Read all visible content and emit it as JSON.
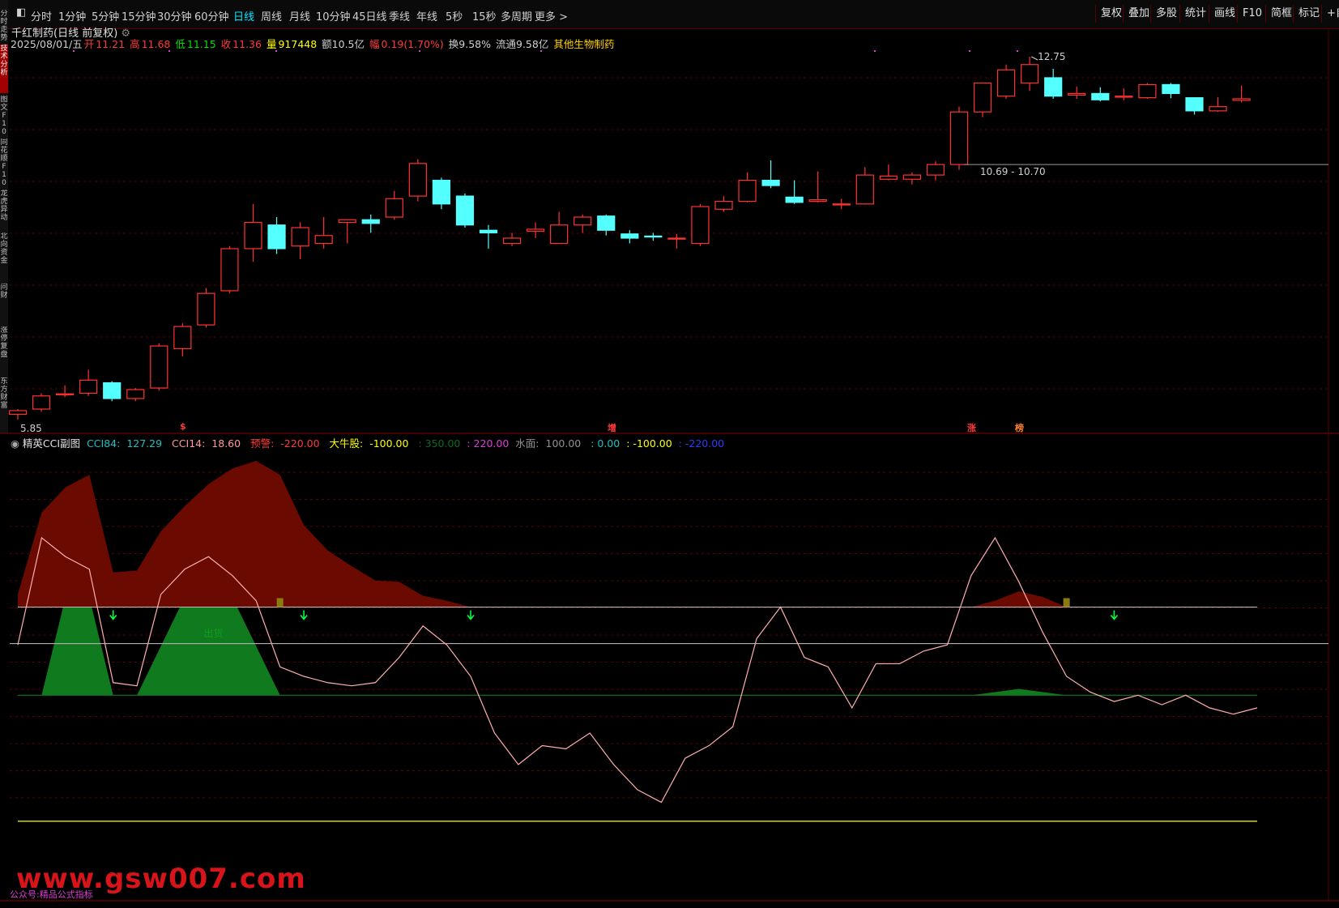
{
  "toolbar": {
    "tabs": [
      "分时",
      "1分钟",
      "5分钟",
      "15分钟",
      "30分钟",
      "60分钟",
      "日线",
      "周线",
      "月线",
      "10分钟",
      "45日线",
      "季线",
      "年线",
      "5秒",
      "15秒",
      "多周期",
      "更多"
    ],
    "active": "日线",
    "right": [
      "复权",
      "叠加",
      "多股",
      "统计",
      "画线",
      "F10",
      "简框",
      "标记",
      "+自"
    ]
  },
  "sidebar": {
    "tabs": [
      "分时走势",
      "技术分析",
      "图文F10",
      "同花顺F10",
      "龙虎异动",
      "北向资金",
      "问财",
      "涨停复盘",
      "东方财富"
    ],
    "active": "技术分析"
  },
  "main": {
    "title": "千红制药(日线 前复权)",
    "date": "2025/08/01/五",
    "open_label": "开",
    "open": "11.21",
    "high_label": "高",
    "high": "11.68",
    "low_label": "低",
    "low": "11.15",
    "close_label": "收",
    "close": "11.36",
    "vol_label": "量",
    "vol": "917448",
    "amount": "额10.5亿",
    "change_label": "幅",
    "change": "0.19(1.70%)",
    "turnover": "换9.58%",
    "float": "流通9.58亿",
    "sector": "其他生物制药",
    "max_label": "12.75",
    "min_label": "5.85",
    "range_label": "10.69 - 10.70",
    "event_markers": [
      "$",
      "增",
      "涨",
      "榜"
    ]
  },
  "indicator": {
    "name": "精英CCI副图",
    "cci84_label": "CCI84:",
    "cci84": "127.29",
    "cci14_label": "CCI14:",
    "cci14": "18.60",
    "warn_label": "预警:",
    "warn": "-220.00",
    "bull_label": "大牛股:",
    "bull": "-100.00",
    "v1": ": 350.00",
    "v2": ": 220.00",
    "water_label": "水面:",
    "water": "100.00",
    "v3": ": 0.00",
    "v4": ": -100.00",
    "v5": ": -220.00",
    "out_label": "出货"
  },
  "watermark": {
    "text": "www.gsw007.com",
    "sub": "公众号:精品公式指标"
  },
  "colors": {
    "up": "#ff3232",
    "down": "#54ffff",
    "bg": "#000000",
    "area_red": "#6b0a00",
    "area_green": "#0f7a1e"
  },
  "chart_data": {
    "type": "candlestick",
    "candles": [
      {
        "o": 5.95,
        "h": 6.05,
        "l": 5.85,
        "c": 6.02
      },
      {
        "o": 6.05,
        "h": 6.35,
        "l": 6.0,
        "c": 6.3
      },
      {
        "o": 6.32,
        "h": 6.5,
        "l": 6.28,
        "c": 6.34
      },
      {
        "o": 6.35,
        "h": 6.8,
        "l": 6.3,
        "c": 6.6
      },
      {
        "o": 6.55,
        "h": 6.58,
        "l": 6.2,
        "c": 6.25
      },
      {
        "o": 6.25,
        "h": 6.45,
        "l": 6.2,
        "c": 6.42
      },
      {
        "o": 6.45,
        "h": 7.3,
        "l": 6.4,
        "c": 7.25
      },
      {
        "o": 7.2,
        "h": 7.68,
        "l": 7.05,
        "c": 7.62
      },
      {
        "o": 7.65,
        "h": 8.35,
        "l": 7.6,
        "c": 8.25
      },
      {
        "o": 8.3,
        "h": 9.15,
        "l": 8.25,
        "c": 9.1
      },
      {
        "o": 9.1,
        "h": 9.95,
        "l": 8.85,
        "c": 9.6
      },
      {
        "o": 9.55,
        "h": 9.7,
        "l": 9.0,
        "c": 9.1
      },
      {
        "o": 9.15,
        "h": 9.6,
        "l": 8.9,
        "c": 9.5
      },
      {
        "o": 9.2,
        "h": 9.7,
        "l": 9.1,
        "c": 9.35
      },
      {
        "o": 9.6,
        "h": 9.65,
        "l": 9.2,
        "c": 9.65
      },
      {
        "o": 9.65,
        "h": 9.75,
        "l": 9.4,
        "c": 9.58
      },
      {
        "o": 9.7,
        "h": 10.2,
        "l": 9.65,
        "c": 10.05
      },
      {
        "o": 10.1,
        "h": 10.8,
        "l": 10.0,
        "c": 10.72
      },
      {
        "o": 10.4,
        "h": 10.45,
        "l": 9.85,
        "c": 9.95
      },
      {
        "o": 10.1,
        "h": 10.15,
        "l": 9.5,
        "c": 9.55
      },
      {
        "o": 9.45,
        "h": 9.55,
        "l": 9.1,
        "c": 9.4
      },
      {
        "o": 9.2,
        "h": 9.4,
        "l": 9.15,
        "c": 9.3
      },
      {
        "o": 9.43,
        "h": 9.6,
        "l": 9.3,
        "c": 9.47
      },
      {
        "o": 9.2,
        "h": 9.8,
        "l": 9.2,
        "c": 9.55
      },
      {
        "o": 9.55,
        "h": 9.75,
        "l": 9.4,
        "c": 9.7
      },
      {
        "o": 9.72,
        "h": 9.75,
        "l": 9.35,
        "c": 9.45
      },
      {
        "o": 9.38,
        "h": 9.45,
        "l": 9.2,
        "c": 9.3
      },
      {
        "o": 9.34,
        "h": 9.4,
        "l": 9.25,
        "c": 9.33
      },
      {
        "o": 9.3,
        "h": 9.38,
        "l": 9.1,
        "c": 9.3
      },
      {
        "o": 9.2,
        "h": 9.95,
        "l": 9.15,
        "c": 9.9
      },
      {
        "o": 9.85,
        "h": 10.1,
        "l": 9.8,
        "c": 10.0
      },
      {
        "o": 10.0,
        "h": 10.55,
        "l": 9.98,
        "c": 10.4
      },
      {
        "o": 10.4,
        "h": 10.78,
        "l": 10.25,
        "c": 10.3
      },
      {
        "o": 10.08,
        "h": 10.4,
        "l": 9.95,
        "c": 9.98
      },
      {
        "o": 10.0,
        "h": 10.57,
        "l": 9.98,
        "c": 10.03
      },
      {
        "o": 9.95,
        "h": 10.05,
        "l": 9.85,
        "c": 9.95
      },
      {
        "o": 9.95,
        "h": 10.65,
        "l": 9.95,
        "c": 10.5
      },
      {
        "o": 10.42,
        "h": 10.7,
        "l": 10.4,
        "c": 10.48
      },
      {
        "o": 10.42,
        "h": 10.55,
        "l": 10.32,
        "c": 10.5
      },
      {
        "o": 10.5,
        "h": 10.76,
        "l": 10.4,
        "c": 10.7
      },
      {
        "o": 10.7,
        "h": 11.8,
        "l": 10.6,
        "c": 11.7
      },
      {
        "o": 11.7,
        "h": 12.25,
        "l": 11.6,
        "c": 12.25
      },
      {
        "o": 12.0,
        "h": 12.6,
        "l": 11.95,
        "c": 12.5
      },
      {
        "o": 12.25,
        "h": 12.75,
        "l": 12.1,
        "c": 12.6
      },
      {
        "o": 12.35,
        "h": 12.52,
        "l": 11.95,
        "c": 12.0
      },
      {
        "o": 12.02,
        "h": 12.18,
        "l": 11.95,
        "c": 12.05
      },
      {
        "o": 12.05,
        "h": 12.17,
        "l": 11.9,
        "c": 11.93
      },
      {
        "o": 11.98,
        "h": 12.15,
        "l": 11.92,
        "c": 12.0
      },
      {
        "o": 11.97,
        "h": 12.25,
        "l": 11.95,
        "c": 12.22
      },
      {
        "o": 12.22,
        "h": 12.25,
        "l": 11.96,
        "c": 12.05
      },
      {
        "o": 11.97,
        "h": 11.98,
        "l": 11.65,
        "c": 11.72
      },
      {
        "o": 11.72,
        "h": 11.98,
        "l": 11.7,
        "c": 11.8
      },
      {
        "o": 11.92,
        "h": 12.2,
        "l": 11.88,
        "c": 11.95
      }
    ],
    "y_range": [
      5.85,
      12.75
    ],
    "cci84": [
      120,
      250,
      290,
      310,
      155,
      158,
      220,
      260,
      295,
      320,
      332,
      310,
      230,
      190,
      165,
      142,
      140,
      118,
      110,
      90,
      70,
      82,
      86,
      71,
      70,
      60,
      50,
      45,
      50,
      53,
      58,
      58,
      55,
      48,
      50,
      50,
      40,
      42,
      42,
      45,
      72,
      110,
      125,
      116,
      96,
      90,
      86,
      88,
      84,
      82,
      76,
      68,
      68
    ],
    "cci14": [
      40,
      210,
      180,
      160,
      -20,
      -25,
      120,
      160,
      180,
      150,
      110,
      5,
      -10,
      -20,
      -25,
      -20,
      20,
      70,
      40,
      -10,
      -100,
      -150,
      -120,
      -125,
      -100,
      -150,
      -190,
      -210,
      -140,
      -120,
      -90,
      50,
      100,
      20,
      5,
      -60,
      10,
      10,
      30,
      40,
      150,
      210,
      140,
      60,
      -10,
      -35,
      -50,
      -40,
      -55,
      -40,
      -60,
      -70,
      -60
    ],
    "bull_threshold": -100,
    "warn_threshold": -220,
    "water_threshold": 100,
    "zero_threshold": 0,
    "chart_range": [
      -280,
      350
    ]
  }
}
